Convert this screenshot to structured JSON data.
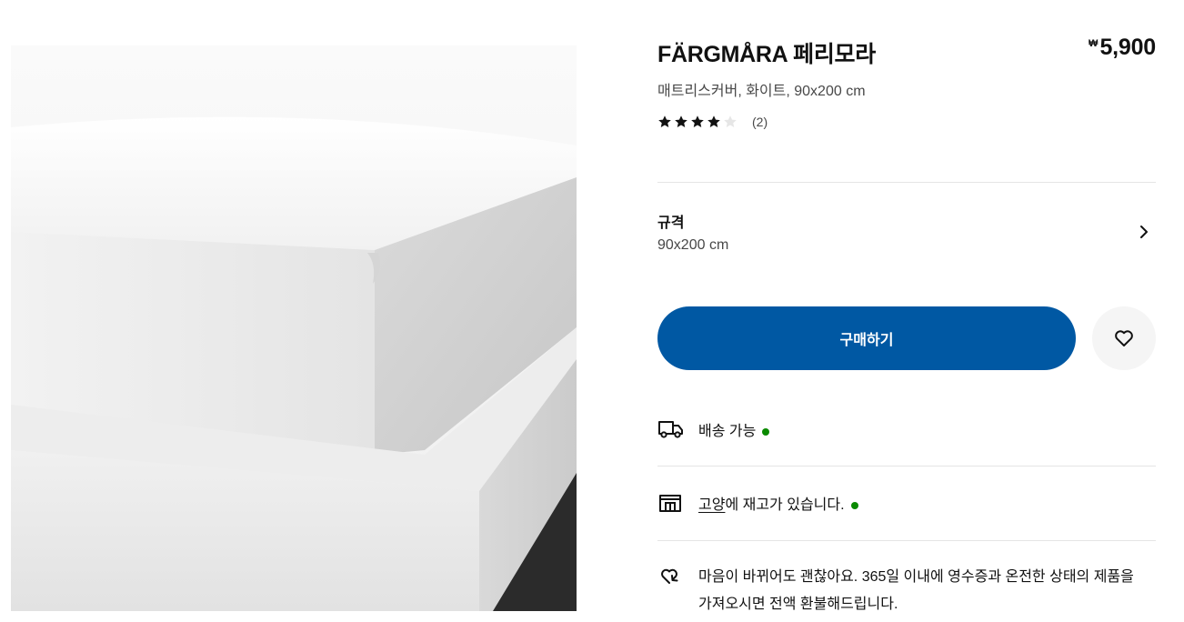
{
  "product": {
    "name": "FÄRGMÅRA 페리모라",
    "description": "매트리스커버, 화이트, 90x200 cm",
    "price_currency": "₩",
    "price_amount": "5,900",
    "rating_stars": 4,
    "rating_max": 5,
    "review_count": "(2)"
  },
  "spec": {
    "label": "규격",
    "value": "90x200 cm"
  },
  "actions": {
    "buy_label": "구매하기"
  },
  "availability": {
    "delivery_text": "배송 가능",
    "store_name": "고양",
    "store_suffix": "에 재고가 있습니다.",
    "status_color": "#0a8a00"
  },
  "return_policy": {
    "text": "마음이 바뀌어도 괜찮아요. 365일 이내에 영수증과 온전한 상태의 제품을 가져오시면 전액 환불해드립니다."
  },
  "colors": {
    "accent": "#0058a3",
    "wishlist_bg": "#f5f5f5"
  },
  "icons": {
    "chevron": "chevron-right-icon",
    "wishlist": "heart-icon",
    "delivery": "truck-icon",
    "store": "store-icon",
    "returns": "return-arrow-heart-icon"
  }
}
